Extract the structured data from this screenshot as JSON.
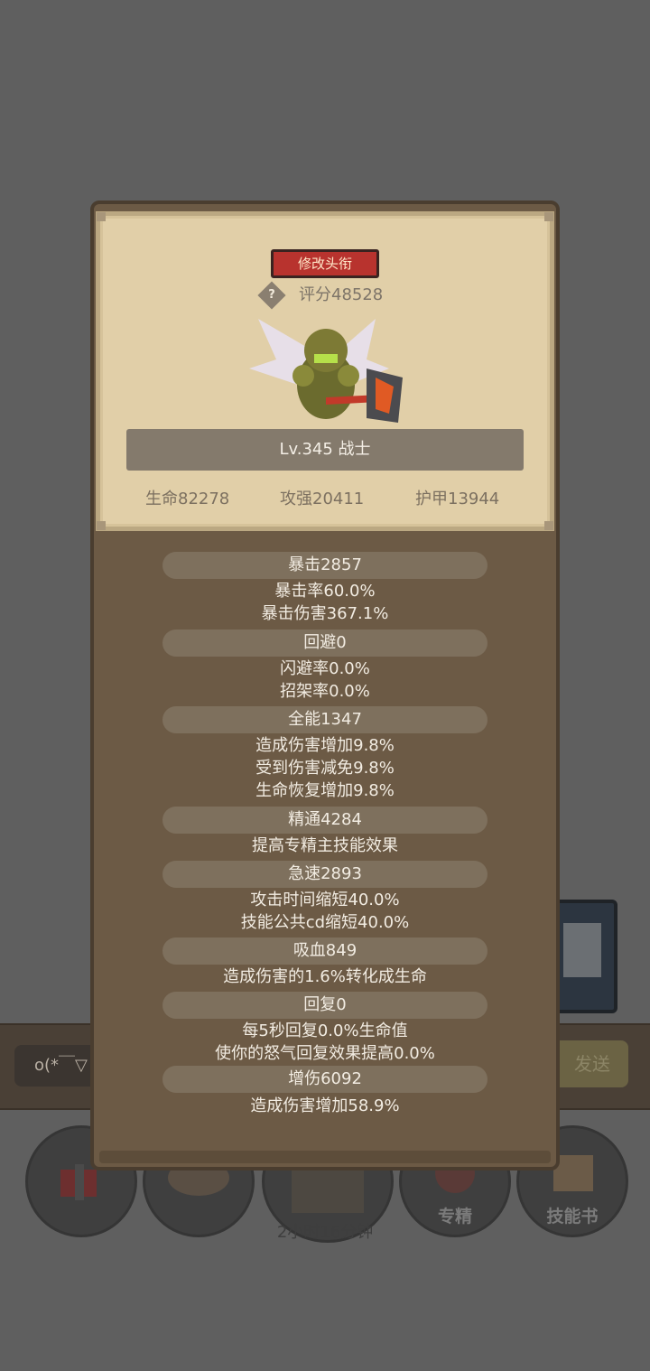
{
  "background": {
    "chat_input_text": "o(*￣▽",
    "send_label": "发送",
    "timer_text": "2小时16分钟",
    "bottom_buttons": [
      {
        "label": ""
      },
      {
        "label": ""
      },
      {
        "label": ""
      },
      {
        "label": "专精"
      },
      {
        "label": "技能书"
      }
    ]
  },
  "card": {
    "rename_button": "修改头衔",
    "help_symbol": "?",
    "score": "评分48528",
    "level_class": "Lv.345 战士",
    "stats": {
      "hp": "生命82278",
      "attack": "攻强20411",
      "armor": "护甲13944"
    }
  },
  "detail_stats": [
    {
      "title": "暴击2857",
      "lines": [
        "暴击率60.0%",
        "暴击伤害367.1%"
      ]
    },
    {
      "title": "回避0",
      "lines": [
        "闪避率0.0%",
        "招架率0.0%"
      ]
    },
    {
      "title": "全能1347",
      "lines": [
        "造成伤害增加9.8%",
        "受到伤害减免9.8%",
        "生命恢复增加9.8%"
      ]
    },
    {
      "title": "精通4284",
      "lines": [
        "提高专精主技能效果"
      ]
    },
    {
      "title": "急速2893",
      "lines": [
        "攻击时间缩短40.0%",
        "技能公共cd缩短40.0%"
      ]
    },
    {
      "title": "吸血849",
      "lines": [
        "造成伤害的1.6%转化成生命"
      ]
    },
    {
      "title": "回复0",
      "lines": [
        "每5秒回复0.0%生命值",
        "使你的怒气回复效果提高0.0%"
      ]
    },
    {
      "title": "增伤6092",
      "lines": [
        "造成伤害增加58.9%"
      ]
    }
  ],
  "colors": {
    "overlay": "#5f5f5f",
    "panel": "#6c5a45",
    "card": "#e1cfa8",
    "rename_button": "#b8332e",
    "stat_pill": "#7e705d"
  }
}
